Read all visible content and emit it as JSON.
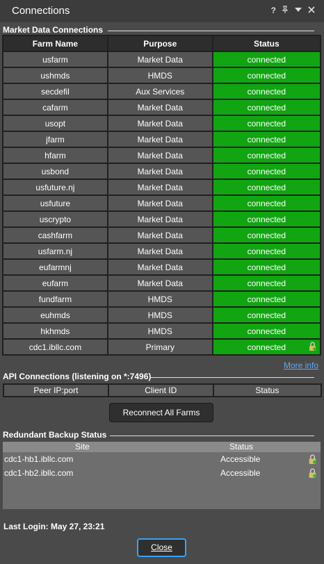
{
  "window": {
    "title": "Connections",
    "help_glyph": "?",
    "icons": [
      "pin-icon",
      "menu-down-icon",
      "close-icon"
    ]
  },
  "market": {
    "header": "Market Data Connections",
    "columns": [
      "Farm Name",
      "Purpose",
      "Status"
    ],
    "rows": [
      {
        "farm": "usfarm",
        "purpose": "Market Data",
        "status": "connected"
      },
      {
        "farm": "ushmds",
        "purpose": "HMDS",
        "status": "connected"
      },
      {
        "farm": "secdefil",
        "purpose": "Aux Services",
        "status": "connected"
      },
      {
        "farm": "cafarm",
        "purpose": "Market Data",
        "status": "connected"
      },
      {
        "farm": "usopt",
        "purpose": "Market Data",
        "status": "connected"
      },
      {
        "farm": "jfarm",
        "purpose": "Market Data",
        "status": "connected"
      },
      {
        "farm": "hfarm",
        "purpose": "Market Data",
        "status": "connected"
      },
      {
        "farm": "usbond",
        "purpose": "Market Data",
        "status": "connected"
      },
      {
        "farm": "usfuture.nj",
        "purpose": "Market Data",
        "status": "connected"
      },
      {
        "farm": "usfuture",
        "purpose": "Market Data",
        "status": "connected"
      },
      {
        "farm": "uscrypto",
        "purpose": "Market Data",
        "status": "connected"
      },
      {
        "farm": "cashfarm",
        "purpose": "Market Data",
        "status": "connected"
      },
      {
        "farm": "usfarm.nj",
        "purpose": "Market Data",
        "status": "connected"
      },
      {
        "farm": "eufarmnj",
        "purpose": "Market Data",
        "status": "connected"
      },
      {
        "farm": "eufarm",
        "purpose": "Market Data",
        "status": "connected"
      },
      {
        "farm": "fundfarm",
        "purpose": "HMDS",
        "status": "connected"
      },
      {
        "farm": "euhmds",
        "purpose": "HMDS",
        "status": "connected"
      },
      {
        "farm": "hkhmds",
        "purpose": "HMDS",
        "status": "connected"
      },
      {
        "farm": "cdc1.ibllc.com",
        "purpose": "Primary",
        "status": "connected",
        "lock": true
      }
    ],
    "more_info": "More info"
  },
  "api": {
    "header": "API Connections (listening on *:7496)",
    "columns": [
      "Peer IP:port",
      "Client ID",
      "Status"
    ]
  },
  "reconnect_label": "Reconnect All Farms",
  "backup": {
    "header": "Redundant Backup Status",
    "columns": [
      "Site",
      "Status"
    ],
    "rows": [
      {
        "site": "cdc1-hb1.ibllc.com",
        "status": "Accessible"
      },
      {
        "site": "cdc1-hb2.ibllc.com",
        "status": "Accessible"
      }
    ]
  },
  "last_login": "Last Login: May 27, 23:21",
  "close_label": "Close",
  "colors": {
    "connected": "#12a512",
    "link": "#5fa8ee",
    "focus": "#3da1f5"
  }
}
